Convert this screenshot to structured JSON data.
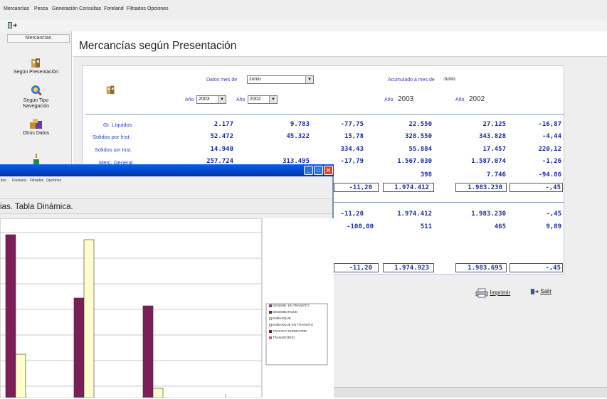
{
  "app": {
    "menu": [
      "Mercancías",
      "Pesca",
      "Generación Consultas",
      "Foreland",
      "Filtrados",
      "Opciones"
    ]
  },
  "sidebar": {
    "header": "Mercancías",
    "items": [
      {
        "label": "Según Presentación",
        "icon": "bags-icon"
      },
      {
        "label": "Según Tipo Navegación",
        "icon": "ship-search-icon"
      },
      {
        "label": "Otros Datos",
        "icon": "boxes-icon"
      }
    ]
  },
  "page": {
    "title": "Mercancías según Presentación"
  },
  "filters": {
    "datos_mes_label": "Datos mes de",
    "month": "Junio",
    "ano_label": "Año",
    "year_a": "2003",
    "year_b": "2002",
    "acumulado_label": "Acumulado a mes de",
    "acumulado_month": "Junio",
    "acc_year_a": "2003",
    "acc_year_b": "2002"
  },
  "table": {
    "rows": [
      {
        "label": "Gr. Líquidos",
        "v1": "2.177",
        "v2": "9.783",
        "pct": "-77,75",
        "a1": "22.550",
        "a2": "27.125",
        "apct": "-16,87"
      },
      {
        "label": "Sólidos por Inst.",
        "v1": "52.472",
        "v2": "45.322",
        "pct": "15,78",
        "a1": "328.550",
        "a2": "343.828",
        "apct": "-4,44"
      },
      {
        "label": "Sólidos sin Inst.",
        "v1": "14.940",
        "v2": "",
        "pct": "334,43",
        "a1": "55.884",
        "a2": "17.457",
        "apct": "220,12"
      },
      {
        "label": "Merc. General",
        "v1": "257.724",
        "v2": "313.495",
        "pct": "-17,79",
        "a1": "1.567.030",
        "a2": "1.587.074",
        "apct": "-1,26"
      },
      {
        "label": "",
        "v1": "",
        "v2": "",
        "pct": "",
        "a1": "398",
        "a2": "7.746",
        "apct": "-94.86"
      }
    ],
    "subtotal1": {
      "pct": "-11,20",
      "a1": "1.974.412",
      "a2": "1.983.230",
      "apct": "-,45"
    },
    "row2": {
      "pct": "-11,20",
      "a1": "1.974.412",
      "a2": "1.983.230",
      "apct": "-,45"
    },
    "row3": {
      "pct": "-100,00",
      "a1": "511",
      "a2": "465",
      "apct": "9,89"
    },
    "total": {
      "pct": "-11,20",
      "a1": "1.974.923",
      "a2": "1.983.695",
      "apct": "-,45"
    }
  },
  "actions": {
    "print_label": "Imprimir",
    "exit_label": "Salir"
  },
  "front_window": {
    "menu": [
      "ltas",
      "Foreland",
      "Filtrados",
      "Opciones"
    ],
    "title": "ias. Tabla Dinámica.",
    "controls": [
      "minimize",
      "maximize",
      "close"
    ]
  },
  "chart_data": {
    "type": "bar",
    "series": [
      {
        "name": "DESEMB. EN TRANSITO",
        "color": "#8b3a7a",
        "values": []
      },
      {
        "name": "DESEMBARQUE",
        "color": "#7b1f5a",
        "values": []
      },
      {
        "name": "EMBARQUE",
        "color": "#ffffcc",
        "values": []
      },
      {
        "name": "EMBARQUE EN TRANSITO",
        "color": "#cde8ff",
        "values": []
      },
      {
        "name": "TRAFICO TERRESTRE",
        "color": "#7a1650",
        "values": []
      },
      {
        "name": "TRANSBORDO",
        "color": "#c06080",
        "values": []
      }
    ],
    "grid": true,
    "legend": "right"
  }
}
